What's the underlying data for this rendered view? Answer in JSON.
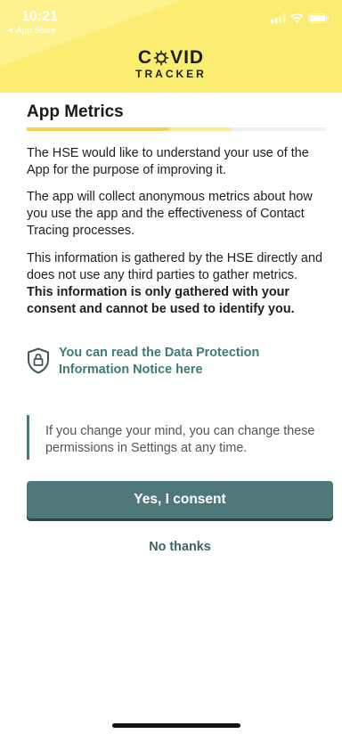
{
  "status_bar": {
    "time": "10:21",
    "back_label": "◄ App Store"
  },
  "logo": {
    "top_left": "C",
    "top_right": "VID",
    "bottom": "TRACKER"
  },
  "page": {
    "title": "App Metrics",
    "progress_fraction": 0.68
  },
  "body": {
    "p1": "The HSE would like to understand your use of the App for the purpose of improving it.",
    "p2": "The app will collect anonymous metrics about how you use the app and the effectiveness of Contact Tracing processes.",
    "p3_plain": "This information is gathered by the HSE directly and does not use any third parties to gather metrics. ",
    "p3_bold": "This information is only gathered with your consent and cannot be used to identify you."
  },
  "notice": {
    "icon": "shield-lock-icon",
    "link_text": "You can read the Data Protection Information Notice here"
  },
  "info": {
    "text": "If you change your mind, you can change these permissions in Settings at any time."
  },
  "actions": {
    "consent_label": "Yes, I consent",
    "decline_label": "No thanks"
  },
  "colors": {
    "header": "#fbed72",
    "accent": "#4e7978",
    "link": "#3f7a76"
  }
}
